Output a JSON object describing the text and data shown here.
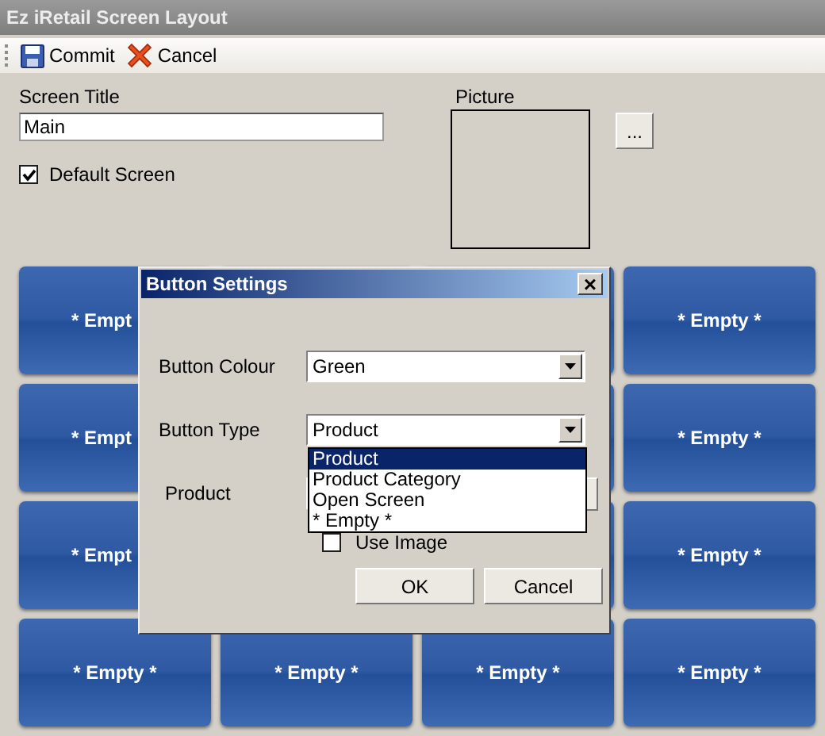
{
  "window": {
    "title": "Ez iRetail Screen Layout"
  },
  "toolbar": [
    {
      "kind": "save",
      "label": "Commit"
    },
    {
      "kind": "cancel",
      "label": "Cancel"
    }
  ],
  "form": {
    "title_label": "Screen Title",
    "title_value": "Main",
    "default_label": "Default Screen",
    "default_checked": true,
    "picture_label": "Picture",
    "browse_button": "..."
  },
  "tile_rows": [
    [
      {
        "label": "* Empt"
      },
      null,
      null,
      {
        "label": "* Empty *"
      }
    ],
    [
      {
        "label": "* Empt"
      },
      null,
      null,
      {
        "label": "* Empty *"
      }
    ],
    [
      {
        "label": "* Empt"
      },
      null,
      null,
      {
        "label": "* Empty *"
      }
    ],
    [
      {
        "label": "* Empty *"
      },
      {
        "label": "* Empty *"
      },
      {
        "label": "* Empty *"
      },
      {
        "label": "* Empty *"
      }
    ]
  ],
  "dialog": {
    "title": "Button Settings",
    "close": "×",
    "colour_label": "Button Colour",
    "colour_value": "Green",
    "type_label": "Button Type",
    "type_value": "Product",
    "type_options": [
      {
        "label": "Product",
        "selected": true
      },
      {
        "label": "Product Category",
        "selected": false
      },
      {
        "label": "Open Screen",
        "selected": false
      },
      {
        "label": "* Empty *",
        "selected": false
      }
    ],
    "product_label": "Product",
    "use_image_label": "Use Image",
    "use_image_checked": false,
    "buttons": [
      "OK",
      "Cancel"
    ]
  }
}
